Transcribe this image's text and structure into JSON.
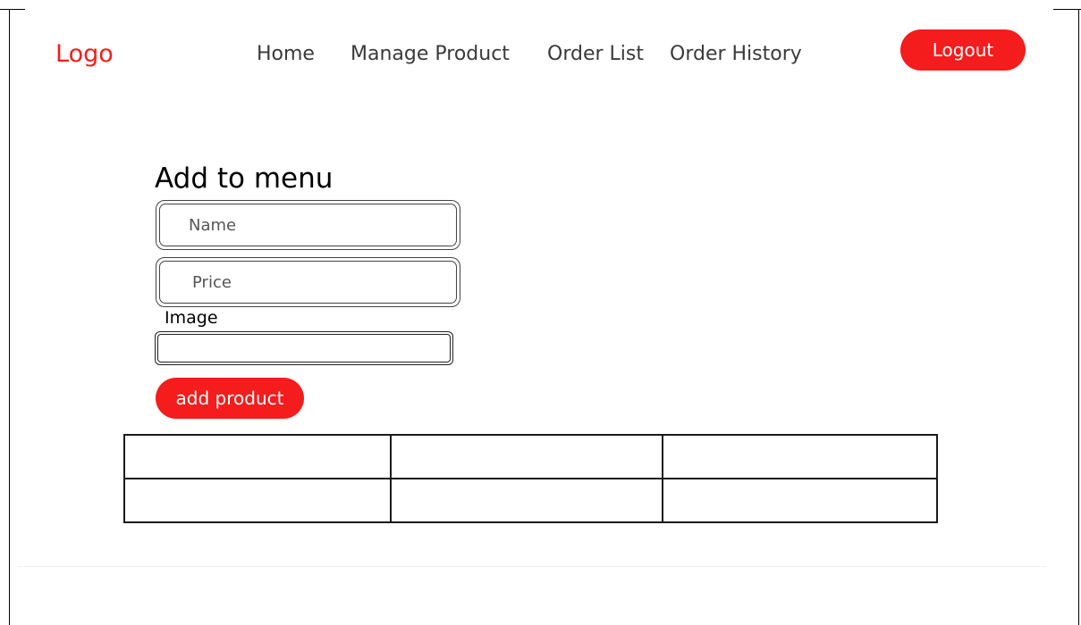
{
  "header": {
    "logo_text": "Logo",
    "nav": [
      {
        "label": "Home"
      },
      {
        "label": "Manage Product"
      },
      {
        "label": "Order List"
      },
      {
        "label": "Order History"
      }
    ],
    "logout_label": "Logout"
  },
  "form": {
    "title": "Add to menu",
    "name_placeholder": "Name",
    "name_value": "",
    "price_placeholder": "Price",
    "price_value": "",
    "image_label": "Image",
    "image_value": "",
    "submit_label": "add product"
  },
  "table": {
    "rows": [
      [
        "",
        "",
        ""
      ],
      [
        "",
        "",
        ""
      ]
    ]
  },
  "colors": {
    "accent": "#f41c1c",
    "logo": "#f41c1c",
    "nav_text": "#3a3a3a",
    "border": "#1a1a1a"
  }
}
